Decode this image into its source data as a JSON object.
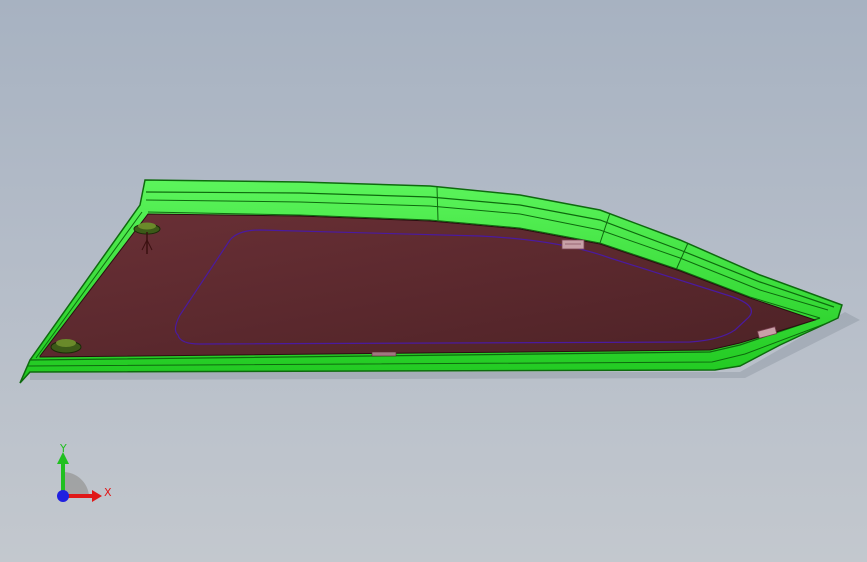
{
  "viewport": {
    "background_top": "#a7b2c1",
    "background_bottom": "#c3c8ce"
  },
  "part": {
    "frame_color": "#2ee82e",
    "frame_dark": "#0e6a0e",
    "panel_color": "#5c2a2f",
    "outline_color": "#4a1aa0"
  },
  "triad": {
    "x_label": "X",
    "y_label": "Y",
    "x_color": "#e01818",
    "y_color": "#20c020",
    "z_color": "#2020e0"
  }
}
